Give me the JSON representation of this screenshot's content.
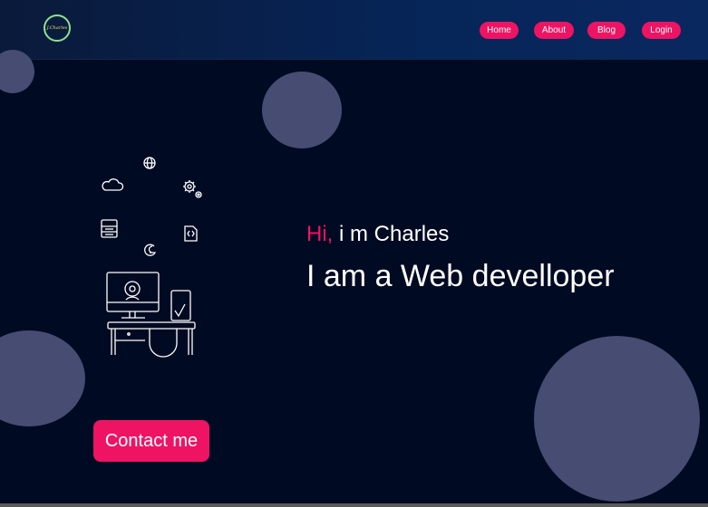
{
  "logo": {
    "text": "J.Charles"
  },
  "nav": {
    "items": [
      {
        "label": "Home"
      },
      {
        "label": "About"
      },
      {
        "label": "Blog"
      },
      {
        "label": "Login"
      }
    ]
  },
  "hero": {
    "greeting_accent": "Hi,",
    "greeting_rest": " i m Charles",
    "headline": "I am a Web develloper",
    "contact_label": "Contact me"
  },
  "colors": {
    "accent": "#ee1463",
    "background": "#000a22",
    "header": "#062558",
    "bubble": "#474c72"
  },
  "icons": [
    "globe-icon",
    "cloud-icon",
    "gear-icon",
    "server-icon",
    "code-file-icon",
    "google-icon",
    "computer-desk-icon"
  ]
}
